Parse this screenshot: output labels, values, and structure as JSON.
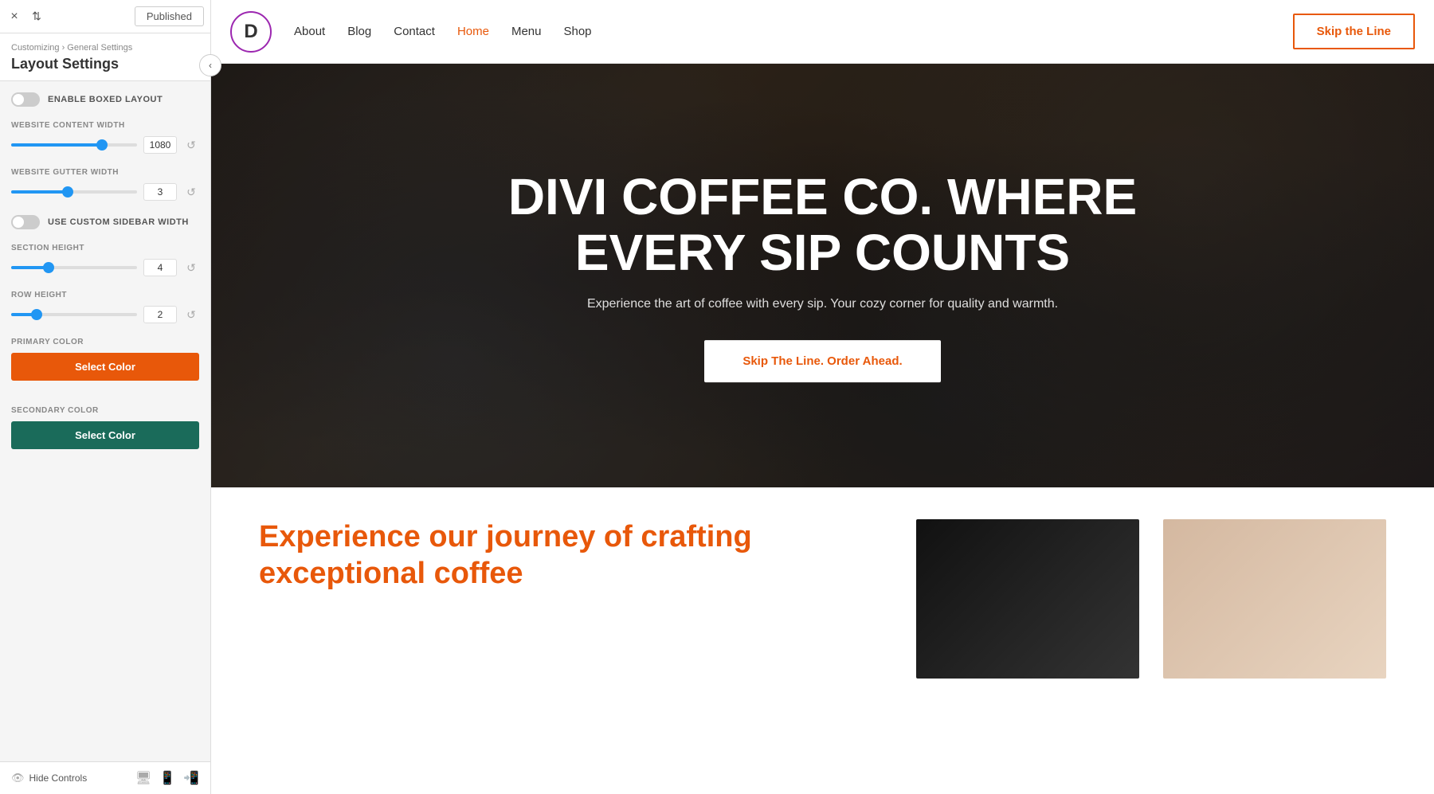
{
  "topbar": {
    "close_icon": "×",
    "sort_icon": "⇅",
    "published_label": "Published"
  },
  "breadcrumb": {
    "text": "Customizing › General Settings",
    "page_title": "Layout Settings"
  },
  "settings": {
    "enable_boxed_label": "Enable Boxed Layout",
    "content_width_label": "Website Content Width",
    "content_width_value": "1080",
    "content_width_pct": 72,
    "gutter_width_label": "Website Gutter Width",
    "gutter_width_value": "3",
    "gutter_width_pct": 45,
    "custom_sidebar_label": "Use Custom Sidebar Width",
    "section_height_label": "Section Height",
    "section_height_value": "4",
    "section_height_pct": 30,
    "row_height_label": "Row Height",
    "row_height_value": "2",
    "row_height_pct": 20,
    "primary_color_label": "Primary Color",
    "primary_color_btn": "Select Color",
    "primary_color": "#e8580a",
    "secondary_color_label": "Secondary Color",
    "secondary_color_btn": "Select Color",
    "secondary_color": "#1a6b5a"
  },
  "bottombar": {
    "hide_label": "Hide Controls"
  },
  "site": {
    "logo_letter": "D",
    "nav": [
      "About",
      "Blog",
      "Contact",
      "Home",
      "Menu",
      "Shop"
    ],
    "nav_active_index": 3,
    "skip_btn": "Skip the Line",
    "hero_title": "DIVI COFFEE CO. WHERE EVERY SIP COUNTS",
    "hero_subtitle": "Experience the art of coffee with every sip. Your cozy corner for quality and warmth.",
    "hero_cta": "Skip The Line. Order Ahead.",
    "below_heading": "Experience our journey of crafting exceptional coffee"
  }
}
